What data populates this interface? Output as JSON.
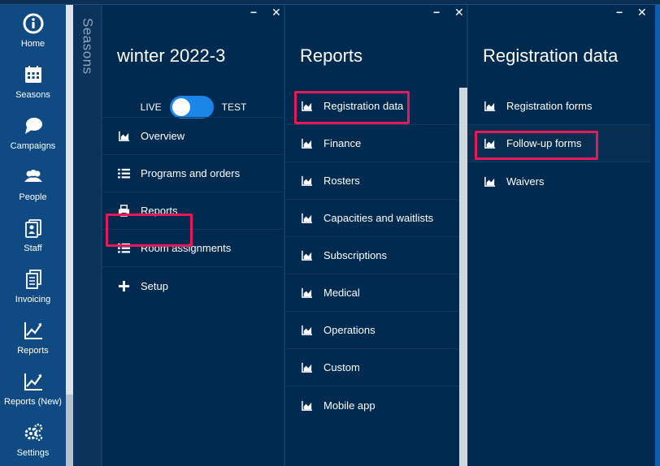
{
  "nav": {
    "items": [
      {
        "label": "Home",
        "icon": "info-icon"
      },
      {
        "label": "Seasons",
        "icon": "calendar-icon"
      },
      {
        "label": "Campaigns",
        "icon": "chat-icon"
      },
      {
        "label": "People",
        "icon": "people-icon"
      },
      {
        "label": "Staff",
        "icon": "staff-icon"
      },
      {
        "label": "Invoicing",
        "icon": "invoice-icon"
      },
      {
        "label": "Reports",
        "icon": "chart-icon"
      },
      {
        "label": "Reports (New)",
        "icon": "chart-icon"
      },
      {
        "label": "Settings",
        "icon": "gears-icon"
      }
    ]
  },
  "seasons_strip": {
    "label": "Seasons"
  },
  "panel1": {
    "title": "winter 2022-3",
    "toggle": {
      "left_label": "LIVE",
      "right_label": "TEST"
    },
    "items": [
      {
        "label": "Overview"
      },
      {
        "label": "Programs and orders"
      },
      {
        "label": "Reports"
      },
      {
        "label": "Room assignments"
      },
      {
        "label": "Setup"
      }
    ]
  },
  "panel2": {
    "title": "Reports",
    "items": [
      {
        "label": "Registration data"
      },
      {
        "label": "Finance"
      },
      {
        "label": "Rosters"
      },
      {
        "label": "Capacities and waitlists"
      },
      {
        "label": "Subscriptions"
      },
      {
        "label": "Medical"
      },
      {
        "label": "Operations"
      },
      {
        "label": "Custom"
      },
      {
        "label": "Mobile app"
      }
    ]
  },
  "panel3": {
    "title": "Registration data",
    "items": [
      {
        "label": "Registration forms"
      },
      {
        "label": "Follow-up forms"
      },
      {
        "label": "Waivers"
      }
    ]
  },
  "controls": {
    "minimize": "−",
    "close": "✕"
  },
  "colors": {
    "nav_bg": "#0f4a82",
    "panel_bg": "#002a50",
    "highlight": "#e8195a",
    "toggle": "#1a86e8"
  }
}
